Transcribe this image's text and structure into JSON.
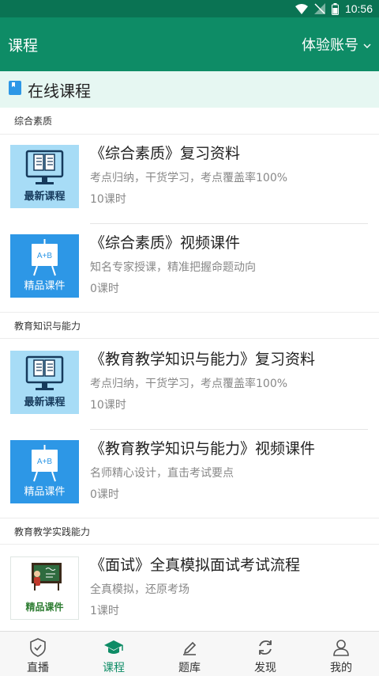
{
  "status": {
    "time": "10:56"
  },
  "header": {
    "title": "课程",
    "account": "体验账号"
  },
  "section": {
    "title": "在线课程"
  },
  "categories": [
    {
      "label": "综合素质"
    },
    {
      "label": "教育知识与能力"
    },
    {
      "label": "教育教学实践能力"
    }
  ],
  "courses": [
    {
      "thumb_label": "最新课程",
      "title": "《综合素质》复习资料",
      "desc": "考点归纳，干货学习，考点覆盖率100%",
      "hours": "10课时"
    },
    {
      "thumb_label": "精品课件",
      "board_text": "A+B",
      "title": "《综合素质》视频课件",
      "desc": "知名专家授课，精准把握命题动向",
      "hours": "0课时"
    },
    {
      "thumb_label": "最新课程",
      "title": "《教育教学知识与能力》复习资料",
      "desc": "考点归纳，干货学习，考点覆盖率100%",
      "hours": "10课时"
    },
    {
      "thumb_label": "精品课件",
      "board_text": "A+B",
      "title": "《教育教学知识与能力》视频课件",
      "desc": "名师精心设计，直击考试要点",
      "hours": "0课时"
    },
    {
      "thumb_label": "精品课件",
      "title": "《面试》全真模拟面试考试流程",
      "desc": "全真模拟，还原考场",
      "hours": "1课时"
    }
  ],
  "nav": [
    {
      "label": "直播",
      "icon": "shield-check-icon"
    },
    {
      "label": "课程",
      "icon": "graduation-cap-icon",
      "active": true
    },
    {
      "label": "题库",
      "icon": "pencil-icon"
    },
    {
      "label": "发现",
      "icon": "refresh-icon"
    },
    {
      "label": "我的",
      "icon": "person-icon"
    }
  ],
  "colors": {
    "primary": "#0e8c66",
    "status_bar": "#0a7353",
    "section_bg": "#e6f7f2",
    "thumb_light": "#a7dcf6",
    "thumb_blue": "#2d97e6"
  }
}
